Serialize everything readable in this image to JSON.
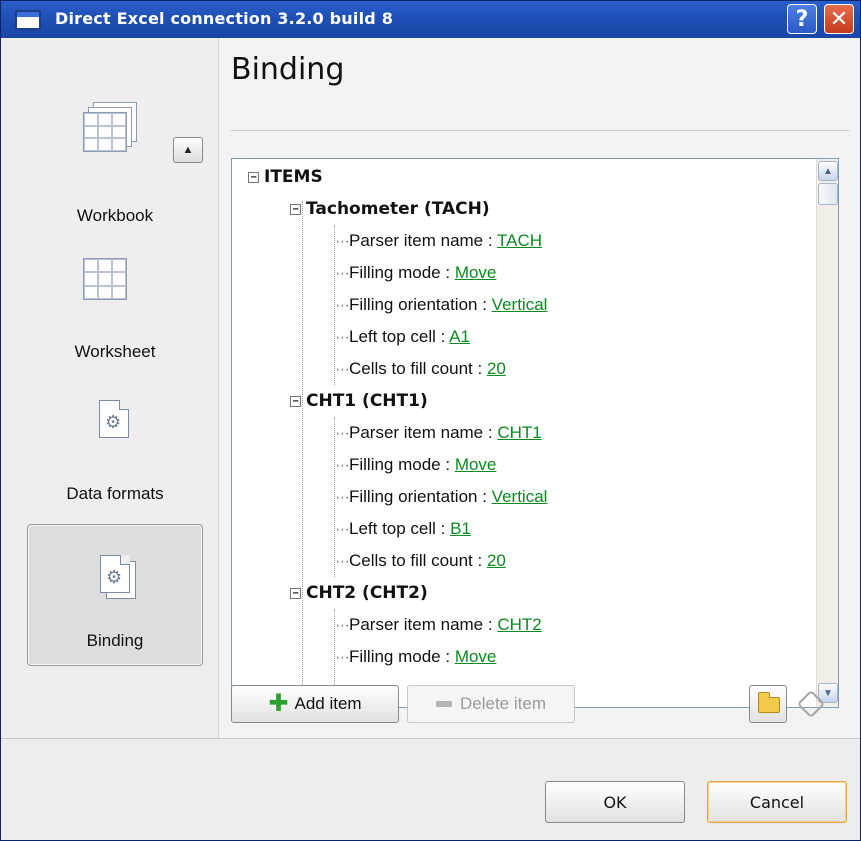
{
  "window": {
    "title": "Direct Excel connection 3.2.0 build 8",
    "help_label": "?",
    "close_label": "✕"
  },
  "nav": {
    "items": [
      {
        "label": "Workbook",
        "icon": "workbook-grid-icon",
        "selected": false
      },
      {
        "label": "Worksheet",
        "icon": "worksheet-grid-icon",
        "selected": false
      },
      {
        "label": "Data formats",
        "icon": "data-formats-gear-icon",
        "selected": false
      },
      {
        "label": "Binding",
        "icon": "binding-gear-icon",
        "selected": true
      }
    ],
    "scroll_up_symbol": "▲"
  },
  "main": {
    "title": "Binding",
    "tree": {
      "root": {
        "expander": "−",
        "label": "ITEMS"
      },
      "groups": [
        {
          "expander": "−",
          "label": "Tachometer (TACH)",
          "fields": [
            {
              "name": "Parser item name : ",
              "value": "TACH"
            },
            {
              "name": "Filling mode : ",
              "value": "Move"
            },
            {
              "name": "Filling orientation : ",
              "value": "Vertical"
            },
            {
              "name": "Left top cell : ",
              "value": "A1"
            },
            {
              "name": "Cells to fill count : ",
              "value": "20"
            }
          ]
        },
        {
          "expander": "−",
          "label": "CHT1 (CHT1)",
          "fields": [
            {
              "name": "Parser item name : ",
              "value": "CHT1"
            },
            {
              "name": "Filling mode : ",
              "value": "Move"
            },
            {
              "name": "Filling orientation : ",
              "value": "Vertical"
            },
            {
              "name": "Left top cell : ",
              "value": "B1"
            },
            {
              "name": "Cells to fill count : ",
              "value": "20"
            }
          ]
        },
        {
          "expander": "−",
          "label": "CHT2 (CHT2)",
          "fields": [
            {
              "name": "Parser item name : ",
              "value": "CHT2"
            },
            {
              "name": "Filling mode : ",
              "value": "Move"
            }
          ]
        }
      ]
    },
    "scrollbar": {
      "up": "▲",
      "down": "▼"
    },
    "add_item_label": "Add item",
    "delete_item_label": "Delete item"
  },
  "footer": {
    "ok_label": "OK",
    "cancel_label": "Cancel"
  },
  "colors": {
    "titlebar": "#1f4fb8",
    "link_value": "#0b8a1f",
    "cancel_focus": "#e2a24a"
  }
}
